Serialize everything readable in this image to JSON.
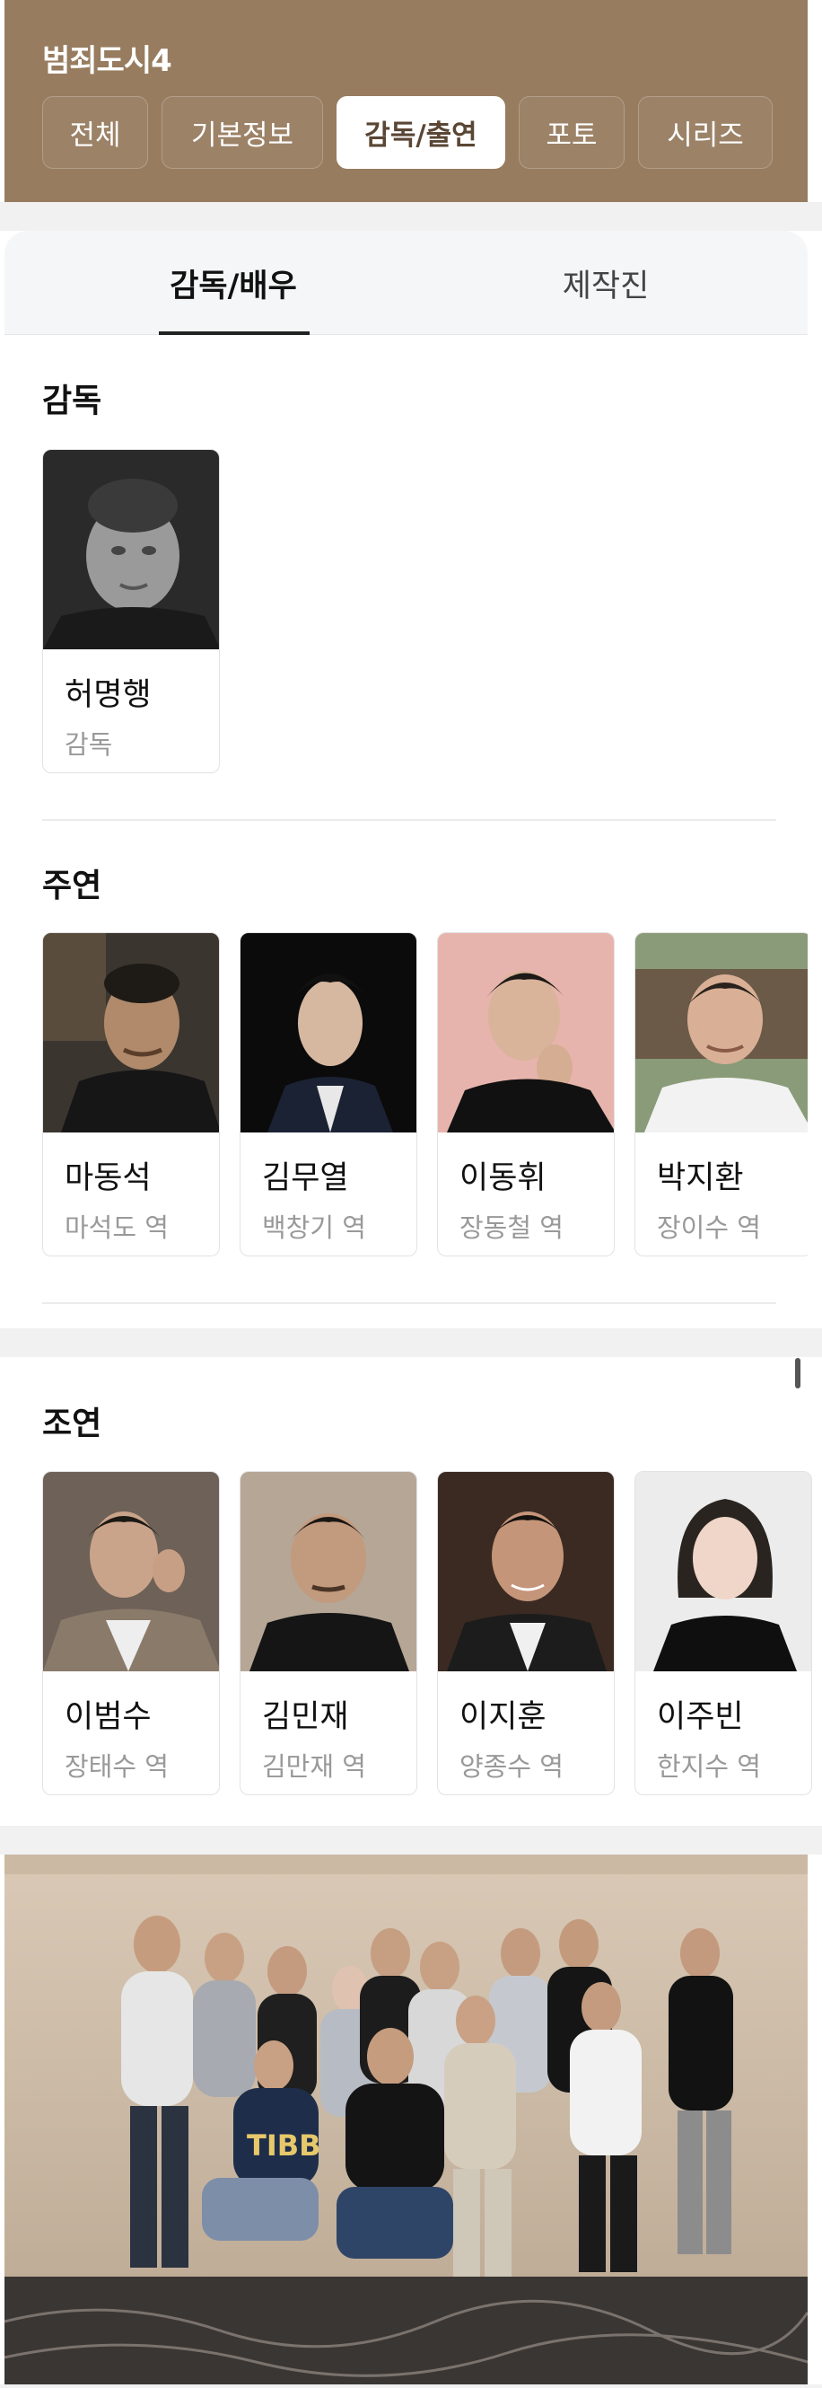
{
  "header": {
    "title": "범죄도시4",
    "tabs": [
      {
        "label": "전체",
        "active": false
      },
      {
        "label": "기본정보",
        "active": false
      },
      {
        "label": "감독/출연",
        "active": true
      },
      {
        "label": "포토",
        "active": false
      },
      {
        "label": "시리즈",
        "active": false
      }
    ]
  },
  "subtabs": [
    {
      "label": "감독/배우",
      "active": true
    },
    {
      "label": "제작진",
      "active": false
    }
  ],
  "sections": {
    "director": {
      "title": "감독",
      "people": [
        {
          "name": "허명행",
          "role": "감독",
          "photo_style": "grayscale"
        }
      ]
    },
    "lead": {
      "title": "주연",
      "people": [
        {
          "name": "마동석",
          "role": "마석도 역"
        },
        {
          "name": "김무열",
          "role": "백창기 역"
        },
        {
          "name": "이동휘",
          "role": "장동철 역"
        },
        {
          "name": "박지환",
          "role": "장이수 역"
        }
      ]
    },
    "supporting": {
      "title": "조연",
      "people": [
        {
          "name": "이범수",
          "role": "장태수 역"
        },
        {
          "name": "김민재",
          "role": "김만재 역"
        },
        {
          "name": "이지훈",
          "role": "양종수 역"
        },
        {
          "name": "이주빈",
          "role": "한지수 역"
        }
      ]
    }
  },
  "colors": {
    "header_bg": "#977c5f",
    "active_tab_text": "#5a4634",
    "page_gap": "#f1f1f2"
  },
  "icons": {
    "scroll_indicator": "scrollbar-thumb"
  }
}
